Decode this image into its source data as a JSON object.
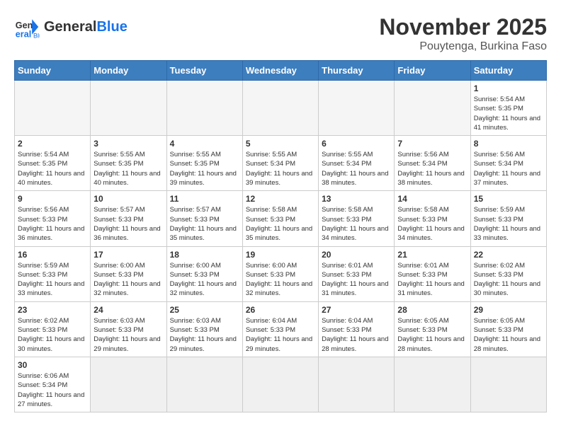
{
  "header": {
    "logo_general": "General",
    "logo_blue": "Blue",
    "month_title": "November 2025",
    "location": "Pouytenga, Burkina Faso"
  },
  "weekdays": [
    "Sunday",
    "Monday",
    "Tuesday",
    "Wednesday",
    "Thursday",
    "Friday",
    "Saturday"
  ],
  "days": [
    {
      "num": "",
      "empty": true
    },
    {
      "num": "",
      "empty": true
    },
    {
      "num": "",
      "empty": true
    },
    {
      "num": "",
      "empty": true
    },
    {
      "num": "",
      "empty": true
    },
    {
      "num": "",
      "empty": true
    },
    {
      "num": "1",
      "sunrise": "5:54 AM",
      "sunset": "5:35 PM",
      "daylight": "11 hours and 41 minutes."
    },
    {
      "num": "2",
      "sunrise": "5:54 AM",
      "sunset": "5:35 PM",
      "daylight": "11 hours and 40 minutes."
    },
    {
      "num": "3",
      "sunrise": "5:55 AM",
      "sunset": "5:35 PM",
      "daylight": "11 hours and 40 minutes."
    },
    {
      "num": "4",
      "sunrise": "5:55 AM",
      "sunset": "5:35 PM",
      "daylight": "11 hours and 39 minutes."
    },
    {
      "num": "5",
      "sunrise": "5:55 AM",
      "sunset": "5:34 PM",
      "daylight": "11 hours and 39 minutes."
    },
    {
      "num": "6",
      "sunrise": "5:55 AM",
      "sunset": "5:34 PM",
      "daylight": "11 hours and 38 minutes."
    },
    {
      "num": "7",
      "sunrise": "5:56 AM",
      "sunset": "5:34 PM",
      "daylight": "11 hours and 38 minutes."
    },
    {
      "num": "8",
      "sunrise": "5:56 AM",
      "sunset": "5:34 PM",
      "daylight": "11 hours and 37 minutes."
    },
    {
      "num": "9",
      "sunrise": "5:56 AM",
      "sunset": "5:33 PM",
      "daylight": "11 hours and 36 minutes."
    },
    {
      "num": "10",
      "sunrise": "5:57 AM",
      "sunset": "5:33 PM",
      "daylight": "11 hours and 36 minutes."
    },
    {
      "num": "11",
      "sunrise": "5:57 AM",
      "sunset": "5:33 PM",
      "daylight": "11 hours and 35 minutes."
    },
    {
      "num": "12",
      "sunrise": "5:58 AM",
      "sunset": "5:33 PM",
      "daylight": "11 hours and 35 minutes."
    },
    {
      "num": "13",
      "sunrise": "5:58 AM",
      "sunset": "5:33 PM",
      "daylight": "11 hours and 34 minutes."
    },
    {
      "num": "14",
      "sunrise": "5:58 AM",
      "sunset": "5:33 PM",
      "daylight": "11 hours and 34 minutes."
    },
    {
      "num": "15",
      "sunrise": "5:59 AM",
      "sunset": "5:33 PM",
      "daylight": "11 hours and 33 minutes."
    },
    {
      "num": "16",
      "sunrise": "5:59 AM",
      "sunset": "5:33 PM",
      "daylight": "11 hours and 33 minutes."
    },
    {
      "num": "17",
      "sunrise": "6:00 AM",
      "sunset": "5:33 PM",
      "daylight": "11 hours and 32 minutes."
    },
    {
      "num": "18",
      "sunrise": "6:00 AM",
      "sunset": "5:33 PM",
      "daylight": "11 hours and 32 minutes."
    },
    {
      "num": "19",
      "sunrise": "6:00 AM",
      "sunset": "5:33 PM",
      "daylight": "11 hours and 32 minutes."
    },
    {
      "num": "20",
      "sunrise": "6:01 AM",
      "sunset": "5:33 PM",
      "daylight": "11 hours and 31 minutes."
    },
    {
      "num": "21",
      "sunrise": "6:01 AM",
      "sunset": "5:33 PM",
      "daylight": "11 hours and 31 minutes."
    },
    {
      "num": "22",
      "sunrise": "6:02 AM",
      "sunset": "5:33 PM",
      "daylight": "11 hours and 30 minutes."
    },
    {
      "num": "23",
      "sunrise": "6:02 AM",
      "sunset": "5:33 PM",
      "daylight": "11 hours and 30 minutes."
    },
    {
      "num": "24",
      "sunrise": "6:03 AM",
      "sunset": "5:33 PM",
      "daylight": "11 hours and 29 minutes."
    },
    {
      "num": "25",
      "sunrise": "6:03 AM",
      "sunset": "5:33 PM",
      "daylight": "11 hours and 29 minutes."
    },
    {
      "num": "26",
      "sunrise": "6:04 AM",
      "sunset": "5:33 PM",
      "daylight": "11 hours and 29 minutes."
    },
    {
      "num": "27",
      "sunrise": "6:04 AM",
      "sunset": "5:33 PM",
      "daylight": "11 hours and 28 minutes."
    },
    {
      "num": "28",
      "sunrise": "6:05 AM",
      "sunset": "5:33 PM",
      "daylight": "11 hours and 28 minutes."
    },
    {
      "num": "29",
      "sunrise": "6:05 AM",
      "sunset": "5:33 PM",
      "daylight": "11 hours and 28 minutes."
    },
    {
      "num": "30",
      "sunrise": "6:06 AM",
      "sunset": "5:34 PM",
      "daylight": "11 hours and 27 minutes.",
      "last": true
    },
    {
      "num": "",
      "empty": true,
      "last": true
    },
    {
      "num": "",
      "empty": true,
      "last": true
    },
    {
      "num": "",
      "empty": true,
      "last": true
    },
    {
      "num": "",
      "empty": true,
      "last": true
    },
    {
      "num": "",
      "empty": true,
      "last": true
    },
    {
      "num": "",
      "empty": true,
      "last": true
    }
  ],
  "labels": {
    "sunrise": "Sunrise:",
    "sunset": "Sunset:",
    "daylight": "Daylight:"
  }
}
